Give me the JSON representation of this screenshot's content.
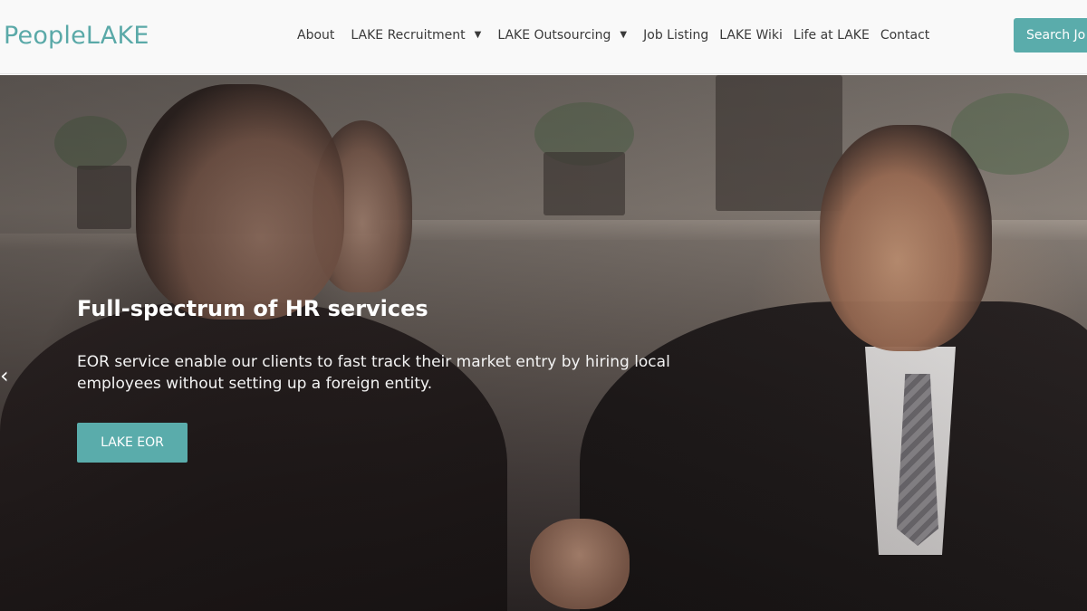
{
  "brand": {
    "logo_people": "People",
    "logo_lake": "LAKE",
    "accent": "#5aacab"
  },
  "nav": {
    "items": [
      {
        "label": "About",
        "has_dropdown": false
      },
      {
        "label": "LAKE Recruitment",
        "has_dropdown": true
      },
      {
        "label": "LAKE Outsourcing",
        "has_dropdown": true
      },
      {
        "label": "Job Listing",
        "has_dropdown": false
      },
      {
        "label": "LAKE Wiki",
        "has_dropdown": false
      },
      {
        "label": "Life at LAKE",
        "has_dropdown": false
      },
      {
        "label": "Contact",
        "has_dropdown": false
      }
    ],
    "search_label": "Search Jo"
  },
  "hero": {
    "title": "Full-spectrum of HR services",
    "description": "EOR service enable our clients to fast track their market entry by hiring local employees without setting up a foreign entity.",
    "cta_label": "LAKE EOR",
    "prev_icon": "chevron-left-icon"
  }
}
